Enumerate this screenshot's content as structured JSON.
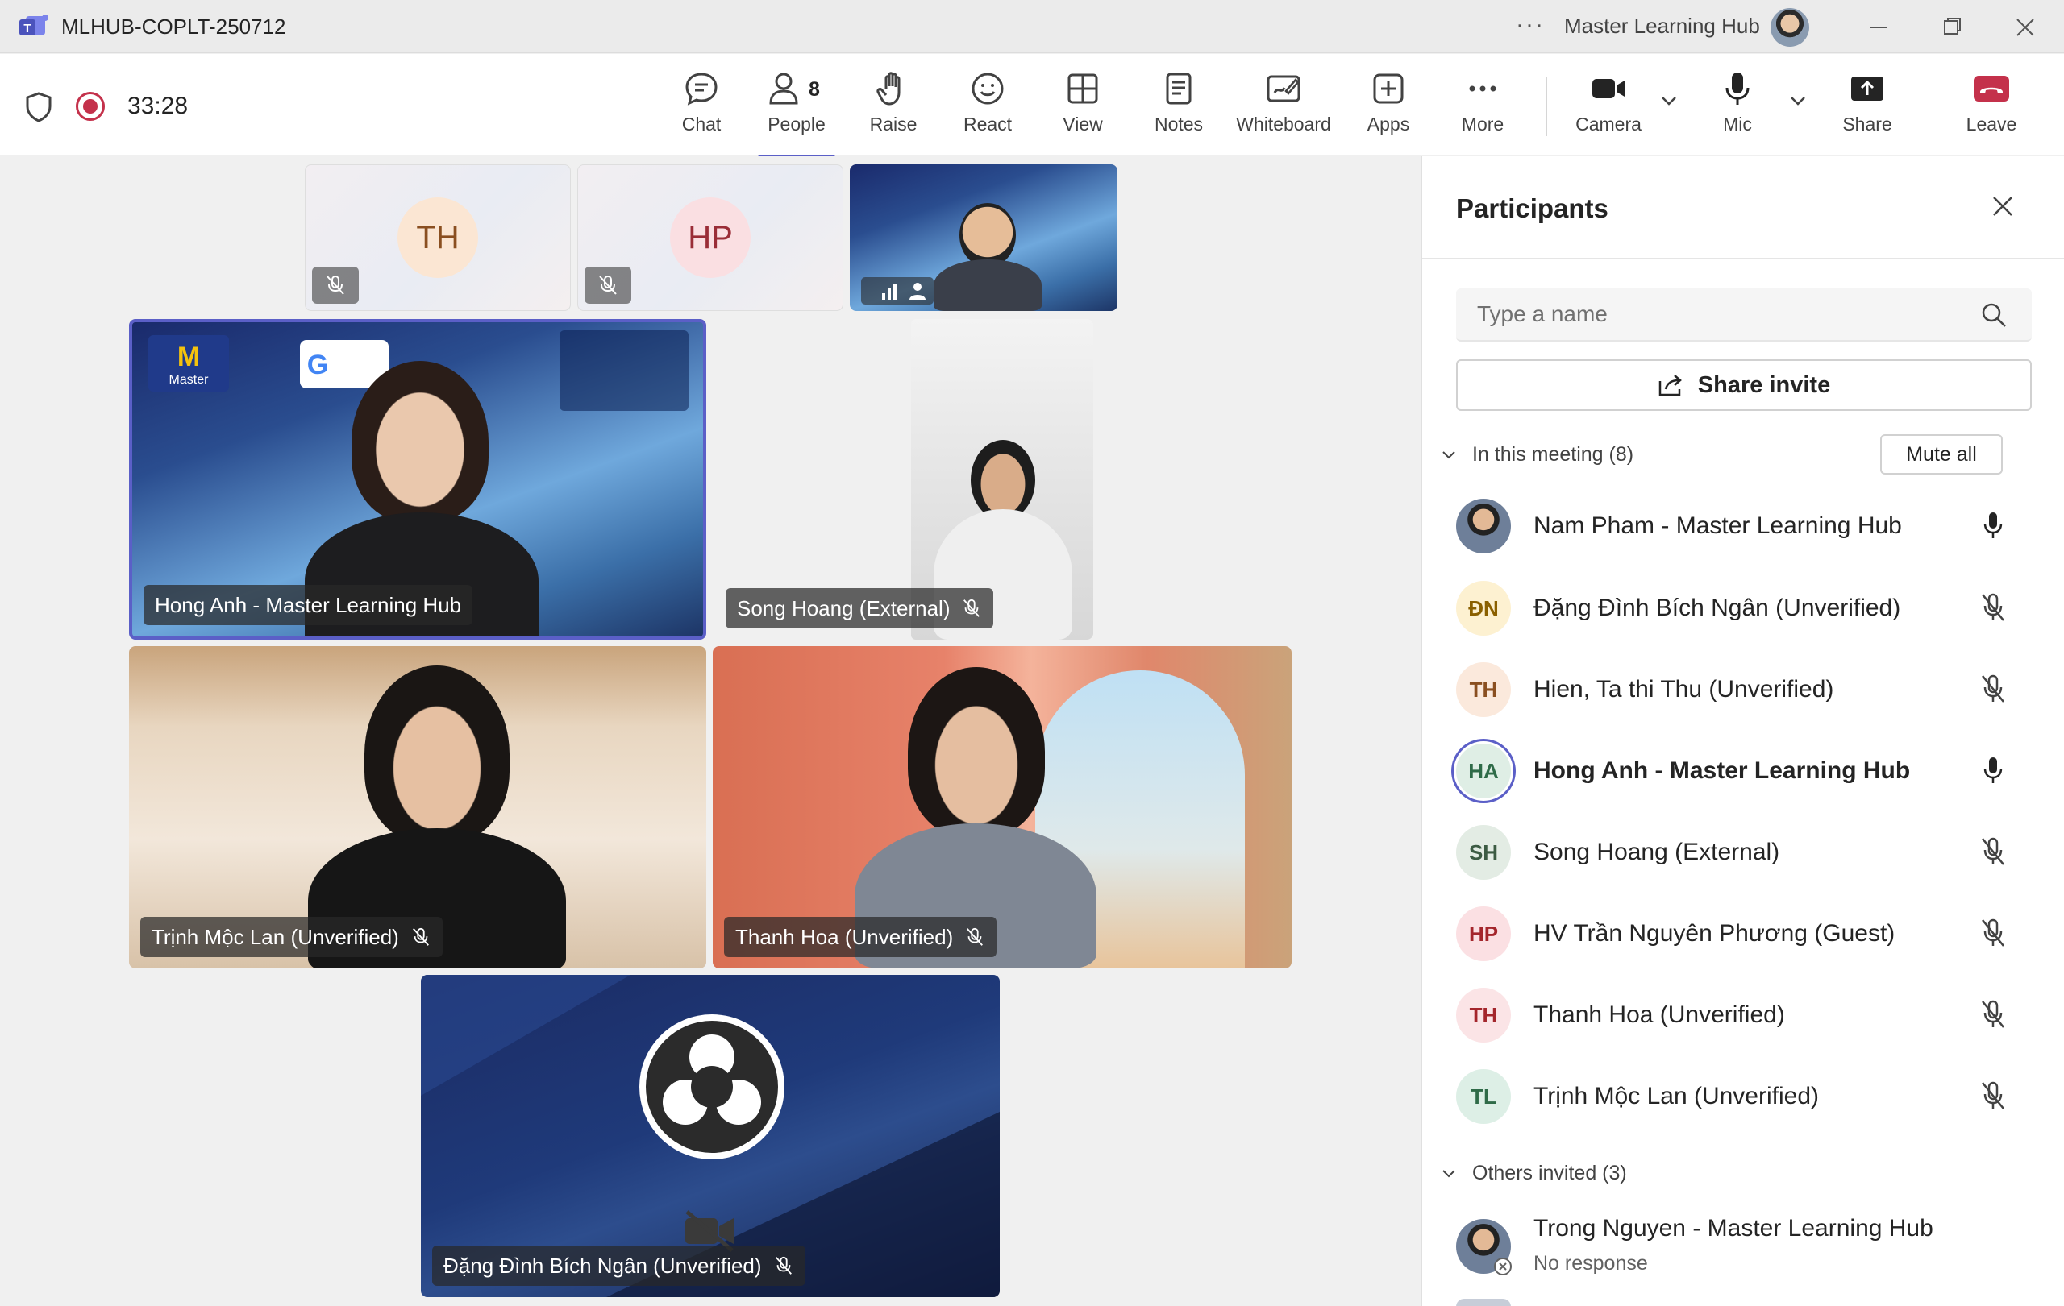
{
  "window": {
    "title": "MLHUB-COPLT-250712",
    "account_name": "Master Learning Hub"
  },
  "toolbar": {
    "timer": "33:28",
    "people_count": "8",
    "items": {
      "chat": "Chat",
      "people": "People",
      "raise": "Raise",
      "react": "React",
      "view": "View",
      "notes": "Notes",
      "whiteboard": "Whiteboard",
      "apps": "Apps",
      "more": "More",
      "camera": "Camera",
      "mic": "Mic",
      "share": "Share",
      "leave": "Leave"
    },
    "colors": {
      "accent": "#5b5fc7",
      "leave": "#c4314b",
      "recording": "#c4314b"
    }
  },
  "stage": {
    "mini_tiles": [
      {
        "initials": "TH",
        "muted": true
      },
      {
        "initials": "HP",
        "muted": true
      }
    ],
    "tiles": {
      "hong_anh": "Hong Anh - Master Learning Hub",
      "song_hoang": "Song Hoang (External)",
      "trinh_moc_lan": "Trịnh Mộc Lan (Unverified)",
      "thanh_hoa": "Thanh Hoa (Unverified)",
      "dang_dinh": "Đặng Đình Bích Ngân (Unverified)"
    }
  },
  "panel": {
    "title": "Participants",
    "search_placeholder": "Type a name",
    "share_invite": "Share invite",
    "in_meeting_label": "In this meeting (8)",
    "mute_all": "Mute all",
    "participants": [
      {
        "initials": "",
        "name": "Nam Pham - Master Learning Hub",
        "mic": "on"
      },
      {
        "initials": "ĐN",
        "name": "Đặng Đình Bích Ngân (Unverified)",
        "mic": "muted"
      },
      {
        "initials": "TH",
        "name": "Hien, Ta thi Thu (Unverified)",
        "mic": "muted"
      },
      {
        "initials": "HA",
        "name": "Hong Anh - Master Learning Hub",
        "mic": "on"
      },
      {
        "initials": "SH",
        "name": "Song Hoang (External)",
        "mic": "muted"
      },
      {
        "initials": "HP",
        "name": "HV Trần Nguyên Phương (Guest)",
        "mic": "muted"
      },
      {
        "initials": "TH",
        "name": "Thanh Hoa (Unverified)",
        "mic": "muted"
      },
      {
        "initials": "TL",
        "name": "Trịnh Mộc Lan (Unverified)",
        "mic": "muted"
      }
    ],
    "others_invited_label": "Others invited (3)",
    "invited": [
      {
        "name": "Trong Nguyen - Master Learning Hub",
        "status": "No response"
      }
    ]
  }
}
